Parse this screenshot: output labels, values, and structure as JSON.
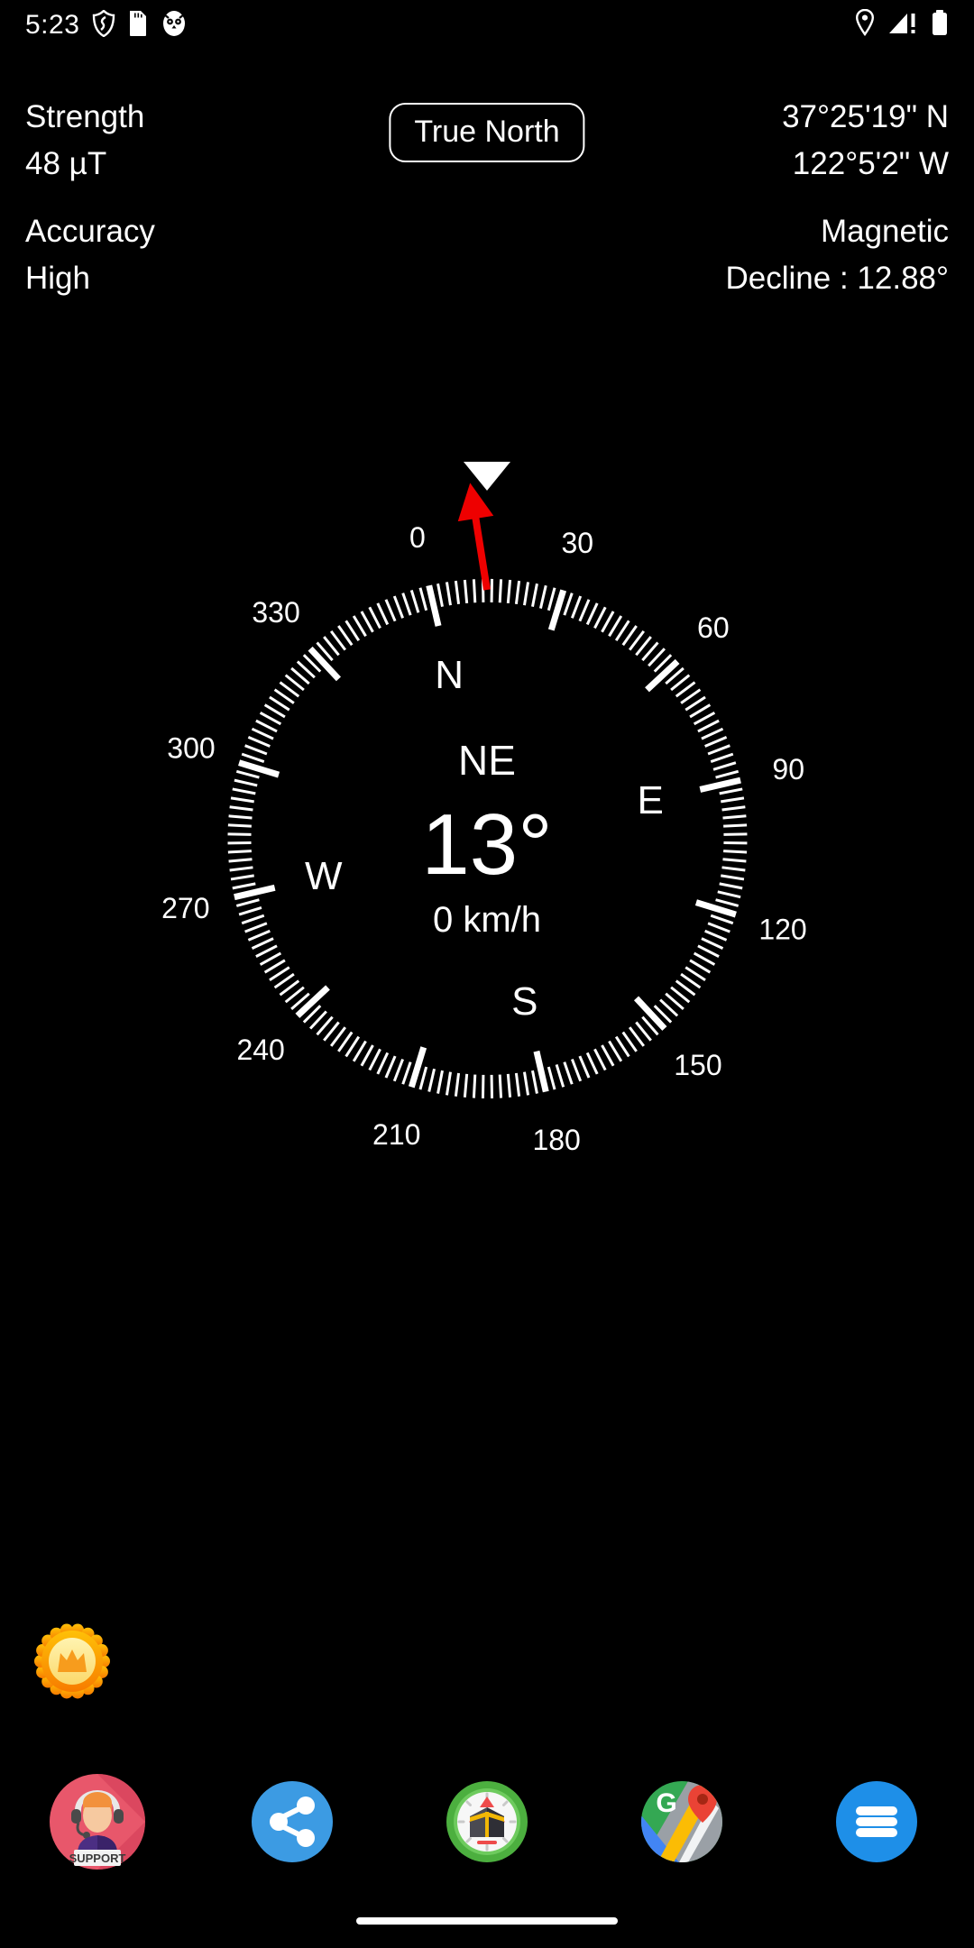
{
  "status_bar": {
    "time": "5:23",
    "left_icons": [
      "shield-icon",
      "sd-card-icon",
      "owl-app-icon"
    ],
    "right_icons": [
      "location-pin-icon",
      "cell-signal-warning-icon",
      "battery-icon"
    ]
  },
  "header": {
    "strength_label": "Strength",
    "strength_value": "48 µT",
    "accuracy_label": "Accuracy",
    "accuracy_value": "High",
    "latitude": "37°25'19\" N",
    "longitude": "122°5'2\" W",
    "magnetic_label": "Magnetic",
    "declination": "Decline : 12.88°",
    "north_mode_button": "True North"
  },
  "compass": {
    "heading_direction": "NE",
    "heading_degrees": "13°",
    "speed": "0 km/h",
    "degree_ticks": [
      "0",
      "30",
      "60",
      "90",
      "120",
      "150",
      "180",
      "210",
      "240",
      "270",
      "300",
      "330"
    ],
    "cardinals": [
      "N",
      "E",
      "S",
      "W"
    ],
    "needle_color": "#ee0000",
    "pointer_color": "#ffffff",
    "dial_rotation_deg": -13,
    "needle_rotation_deg": -9
  },
  "premium": {
    "name": "premium-crown-badge",
    "ring_color": "#F7941D",
    "face_color": "#FBE59A"
  },
  "bottom_nav": [
    {
      "name": "support-button",
      "label": "SUPPORT",
      "color": "#E8576B"
    },
    {
      "name": "share-button",
      "label": "Share",
      "color": "#3C9BE3"
    },
    {
      "name": "qibla-compass-button",
      "label": "Qibla",
      "color": "#4CAF3F"
    },
    {
      "name": "google-maps-button",
      "label": "Maps",
      "color": "#34A853"
    },
    {
      "name": "menu-button",
      "label": "Menu",
      "color": "#1E8FE8"
    }
  ]
}
